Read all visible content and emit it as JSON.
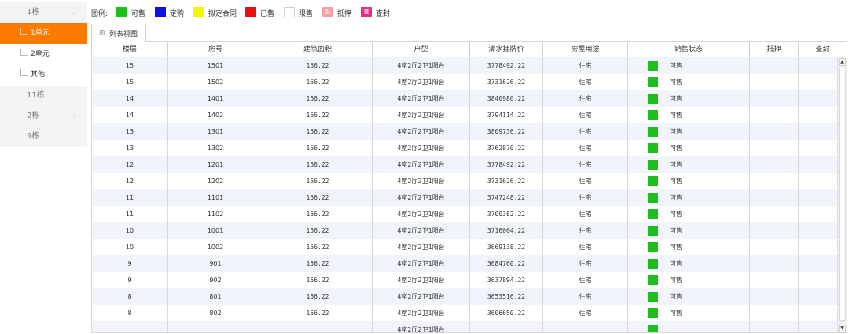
{
  "sidebar": {
    "buildings": [
      {
        "label": "1栋",
        "chevron": "⌄"
      },
      {
        "label": "11栋",
        "chevron": "›"
      },
      {
        "label": "2栋",
        "chevron": "›"
      },
      {
        "label": "9栋",
        "chevron": "›"
      }
    ],
    "units": [
      {
        "label": "1单元",
        "active": true
      },
      {
        "label": "2单元",
        "active": false
      },
      {
        "label": "其他",
        "active": false
      }
    ]
  },
  "legend": {
    "title": "图例:",
    "items": [
      {
        "label": "可售",
        "color": "#1dbf1d",
        "mark": ""
      },
      {
        "label": "定购",
        "color": "#1010e0",
        "mark": ""
      },
      {
        "label": "拟定合同",
        "color": "#f5f500",
        "mark": ""
      },
      {
        "label": "已售",
        "color": "#e81010",
        "mark": ""
      },
      {
        "label": "限售",
        "color": "#ffffff",
        "mark": ""
      },
      {
        "label": "抵押",
        "color": "#f0a0a8",
        "mark": "抵"
      },
      {
        "label": "查封",
        "color": "#e0308a",
        "mark": "查"
      }
    ]
  },
  "tab": {
    "icon": "grid-icon",
    "label": "列表视图"
  },
  "table": {
    "columns": [
      "楼层",
      "房号",
      "建筑面积",
      "户型",
      "清水挂牌价",
      "房屋用途",
      "销售状态",
      "抵押",
      "查封"
    ],
    "status_color": "#1dbf1d",
    "rows": [
      {
        "floor": "15",
        "room": "1501",
        "area": "156.22",
        "layout": "4室2厅2卫1阳台",
        "price": "3778492.22",
        "usage": "住宅",
        "status": "可售"
      },
      {
        "floor": "15",
        "room": "1502",
        "area": "156.22",
        "layout": "4室2厅2卫1阳台",
        "price": "3731626.22",
        "usage": "住宅",
        "status": "可售"
      },
      {
        "floor": "14",
        "room": "1401",
        "area": "156.22",
        "layout": "4室2厅2卫1阳台",
        "price": "3840980.22",
        "usage": "住宅",
        "status": "可售"
      },
      {
        "floor": "14",
        "room": "1402",
        "area": "156.22",
        "layout": "4室2厅2卫1阳台",
        "price": "3794114.22",
        "usage": "住宅",
        "status": "可售"
      },
      {
        "floor": "13",
        "room": "1301",
        "area": "156.22",
        "layout": "4室2厅2卫1阳台",
        "price": "3809736.22",
        "usage": "住宅",
        "status": "可售"
      },
      {
        "floor": "13",
        "room": "1302",
        "area": "156.22",
        "layout": "4室2厅2卫1阳台",
        "price": "3762870.22",
        "usage": "住宅",
        "status": "可售"
      },
      {
        "floor": "12",
        "room": "1201",
        "area": "156.22",
        "layout": "4室2厅2卫1阳台",
        "price": "3778492.22",
        "usage": "住宅",
        "status": "可售"
      },
      {
        "floor": "12",
        "room": "1202",
        "area": "156.22",
        "layout": "4室2厅2卫1阳台",
        "price": "3731626.22",
        "usage": "住宅",
        "status": "可售"
      },
      {
        "floor": "11",
        "room": "1101",
        "area": "156.22",
        "layout": "4室2厅2卫1阳台",
        "price": "3747248.22",
        "usage": "住宅",
        "status": "可售"
      },
      {
        "floor": "11",
        "room": "1102",
        "area": "156.22",
        "layout": "4室2厅2卫1阳台",
        "price": "3700382.22",
        "usage": "住宅",
        "status": "可售"
      },
      {
        "floor": "10",
        "room": "1001",
        "area": "156.22",
        "layout": "4室2厅2卫1阳台",
        "price": "3716004.22",
        "usage": "住宅",
        "status": "可售"
      },
      {
        "floor": "10",
        "room": "1002",
        "area": "156.22",
        "layout": "4室2厅2卫1阳台",
        "price": "3669138.22",
        "usage": "住宅",
        "status": "可售"
      },
      {
        "floor": "9",
        "room": "901",
        "area": "156.22",
        "layout": "4室2厅2卫1阳台",
        "price": "3684760.22",
        "usage": "住宅",
        "status": "可售"
      },
      {
        "floor": "9",
        "room": "902",
        "area": "156.22",
        "layout": "4室2厅2卫1阳台",
        "price": "3637894.22",
        "usage": "住宅",
        "status": "可售"
      },
      {
        "floor": "8",
        "room": "801",
        "area": "156.22",
        "layout": "4室2厅2卫1阳台",
        "price": "3653516.22",
        "usage": "住宅",
        "status": "可售"
      },
      {
        "floor": "8",
        "room": "802",
        "area": "156.22",
        "layout": "4室2厅2卫1阳台",
        "price": "3606650.22",
        "usage": "住宅",
        "status": "可售"
      },
      {
        "floor": "",
        "room": "",
        "area": "",
        "layout": "4室2厅2卫1阳台",
        "price": "",
        "usage": "",
        "status": ""
      }
    ]
  },
  "scrollbar": {
    "up_icon": "▲",
    "down_icon": "▼"
  }
}
